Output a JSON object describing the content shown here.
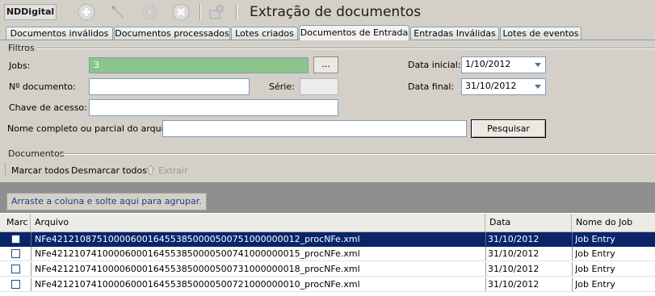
{
  "toolbar": {
    "logo_text": "NDDigital",
    "title": "Extração de documentos",
    "icons": [
      "add-icon",
      "edit-icon",
      "settings-icon",
      "cancel-icon",
      "tools-icon"
    ]
  },
  "tabs": [
    {
      "label": "Documentos inválidos",
      "active": false
    },
    {
      "label": "Documentos processados",
      "active": false
    },
    {
      "label": "Lotes criados",
      "active": false
    },
    {
      "label": "Documentos de Entrada",
      "active": true
    },
    {
      "label": "Entradas Inválidas",
      "active": false
    },
    {
      "label": "Lotes de eventos",
      "active": false
    }
  ],
  "filters": {
    "title": "Filtros",
    "jobs_label": "Jobs:",
    "jobs_value": "3",
    "browse_label": "...",
    "doc_number_label": "Nº documento:",
    "doc_number_value": "",
    "serie_label": "Série:",
    "serie_value": "",
    "access_key_label": "Chave de acesso:",
    "access_key_value": "",
    "filename_label": "Nome completo ou parcial do arquivo:",
    "filename_value": "",
    "start_date_label": "Data inicial:",
    "start_date_value": "1/10/2012",
    "end_date_label": "Data final:",
    "end_date_value": "31/10/2012",
    "search_label": "Pesquisar"
  },
  "documents": {
    "title": "Documentos",
    "mark_all": "Marcar todos",
    "unmark_all": "Desmarcar todos",
    "extract": "Extrair",
    "group_hint": "Arraste a coluna e solte aqui para agrupar.",
    "columns": [
      "Marc",
      "Arquivo",
      "Data",
      "Nome do Job"
    ],
    "rows": [
      {
        "file": "NFe42121087510000600164553850000500751000000012_procNFe.xml",
        "date": "31/10/2012",
        "job": "Job Entry",
        "selected": true
      },
      {
        "file": "NFe42121074100006000164553850000500741000000015_procNFe.xml",
        "date": "31/10/2012",
        "job": "Job Entry",
        "selected": false
      },
      {
        "file": "NFe42121074100006000164553850000500731000000018_procNFe.xml",
        "date": "31/10/2012",
        "job": "Job Entry",
        "selected": false
      },
      {
        "file": "NFe42121074100006000164553850000500721000000010_procNFe.xml",
        "date": "31/10/2012",
        "job": "Job Entry",
        "selected": false
      }
    ]
  },
  "colors": {
    "background": "#d4d0c8",
    "selection": "#0a246a",
    "jobs_field": "#8bc58b",
    "group_panel": "#8f8f8f"
  }
}
